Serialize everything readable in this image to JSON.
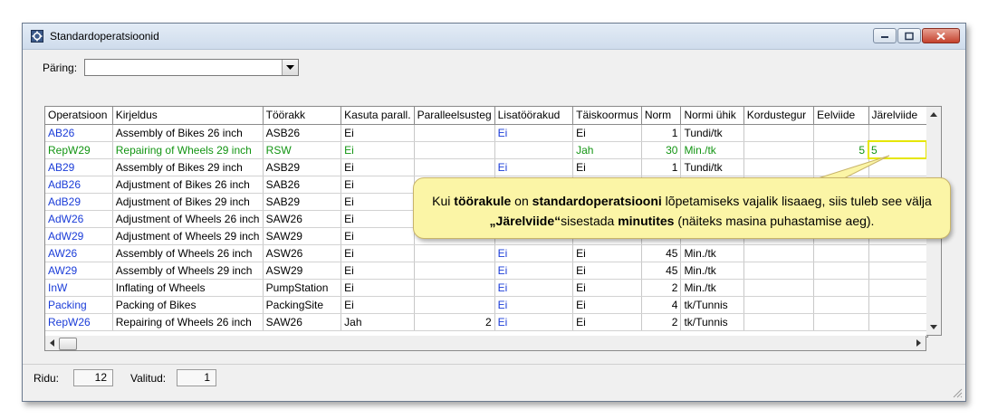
{
  "window": {
    "title": "Standardoperatsioonid",
    "accent": "#e6e600"
  },
  "query": {
    "label": "Päring:",
    "value": ""
  },
  "table": {
    "columns": [
      "Operatsioon",
      "Kirjeldus",
      "Töörakk",
      "Kasuta parall.",
      "Paralleelsusteg",
      "Lisatöörakud",
      "Täiskoormus",
      "Norm",
      "Normi ühik",
      "Kordustegur",
      "Eelviide",
      "Järelviide"
    ],
    "rows": [
      {
        "code": "AB26",
        "desc": "Assembly of Bikes 26 inch",
        "cell": "ASB26",
        "parallel": "Ei",
        "degree": "",
        "extra": "Ei",
        "full": "Ei",
        "norm": "1",
        "unit": "Tundi/tk",
        "factor": "",
        "pre": "",
        "post": ""
      },
      {
        "code": "RepW29",
        "desc": "Repairing of Wheels 29 inch",
        "cell": "RSW",
        "parallel": "Ei",
        "degree": "",
        "extra": "",
        "full": "Jah",
        "norm": "30",
        "unit": "Min./tk",
        "factor": "",
        "pre": "5",
        "post": "5",
        "selected": true
      },
      {
        "code": "AB29",
        "desc": "Assembly of Bikes 29 inch",
        "cell": "ASB29",
        "parallel": "Ei",
        "degree": "",
        "extra": "Ei",
        "full": "Ei",
        "norm": "1",
        "unit": "Tundi/tk",
        "factor": "",
        "pre": "",
        "post": ""
      },
      {
        "code": "AdB26",
        "desc": "Adjustment of Bikes 26 inch",
        "cell": "SAB26",
        "parallel": "Ei",
        "degree": "",
        "extra": "",
        "full": "",
        "norm": "",
        "unit": "",
        "factor": "",
        "pre": "",
        "post": ""
      },
      {
        "code": "AdB29",
        "desc": "Adjustment of Bikes 29 inch",
        "cell": "SAB29",
        "parallel": "Ei",
        "degree": "",
        "extra": "",
        "full": "",
        "norm": "",
        "unit": "",
        "factor": "",
        "pre": "",
        "post": ""
      },
      {
        "code": "AdW26",
        "desc": "Adjustment of Wheels 26 inch",
        "cell": "SAW26",
        "parallel": "Ei",
        "degree": "",
        "extra": "",
        "full": "",
        "norm": "",
        "unit": "",
        "factor": "",
        "pre": "",
        "post": ""
      },
      {
        "code": "AdW29",
        "desc": "Adjustment of Wheels 29 inch",
        "cell": "SAW29",
        "parallel": "Ei",
        "degree": "",
        "extra": "",
        "full": "",
        "norm": "",
        "unit": "",
        "factor": "",
        "pre": "",
        "post": ""
      },
      {
        "code": "AW26",
        "desc": "Assembly of Wheels 26 inch",
        "cell": "ASW26",
        "parallel": "Ei",
        "degree": "",
        "extra": "Ei",
        "full": "Ei",
        "norm": "45",
        "unit": "Min./tk",
        "factor": "",
        "pre": "",
        "post": ""
      },
      {
        "code": "AW29",
        "desc": "Assembly of Wheels 29 inch",
        "cell": "ASW29",
        "parallel": "Ei",
        "degree": "",
        "extra": "Ei",
        "full": "Ei",
        "norm": "45",
        "unit": "Min./tk",
        "factor": "",
        "pre": "",
        "post": ""
      },
      {
        "code": "InW",
        "desc": "Inflating of Wheels",
        "cell": "PumpStation",
        "parallel": "Ei",
        "degree": "",
        "extra": "Ei",
        "full": "Ei",
        "norm": "2",
        "unit": "Min./tk",
        "factor": "",
        "pre": "",
        "post": ""
      },
      {
        "code": "Packing",
        "desc": "Packing of Bikes",
        "cell": "PackingSite",
        "parallel": "Ei",
        "degree": "",
        "extra": "Ei",
        "full": "Ei",
        "norm": "4",
        "unit": "tk/Tunnis",
        "factor": "",
        "pre": "",
        "post": ""
      },
      {
        "code": "RepW26",
        "desc": "Repairing of Wheels 26 inch",
        "cell": "SAW26",
        "parallel": "Jah",
        "degree": "2",
        "extra": "Ei",
        "full": "Ei",
        "norm": "2",
        "unit": "tk/Tunnis",
        "factor": "",
        "pre": "",
        "post": ""
      }
    ]
  },
  "status": {
    "rows_label": "Ridu:",
    "rows_value": "12",
    "selected_label": "Valitud:",
    "selected_value": "1"
  },
  "callout": {
    "p1": "Kui ",
    "b1": "töörakule",
    "p2": " on  ",
    "b2": "standardoperatsiooni",
    "p3": " lõpetamiseks vajalik lisaaeg, siis tuleb see välja ",
    "b3": "„Järelviide“",
    "p4": "sisestada ",
    "b4": "minutites",
    "p5": " (näiteks masina puhastamise aeg)."
  }
}
